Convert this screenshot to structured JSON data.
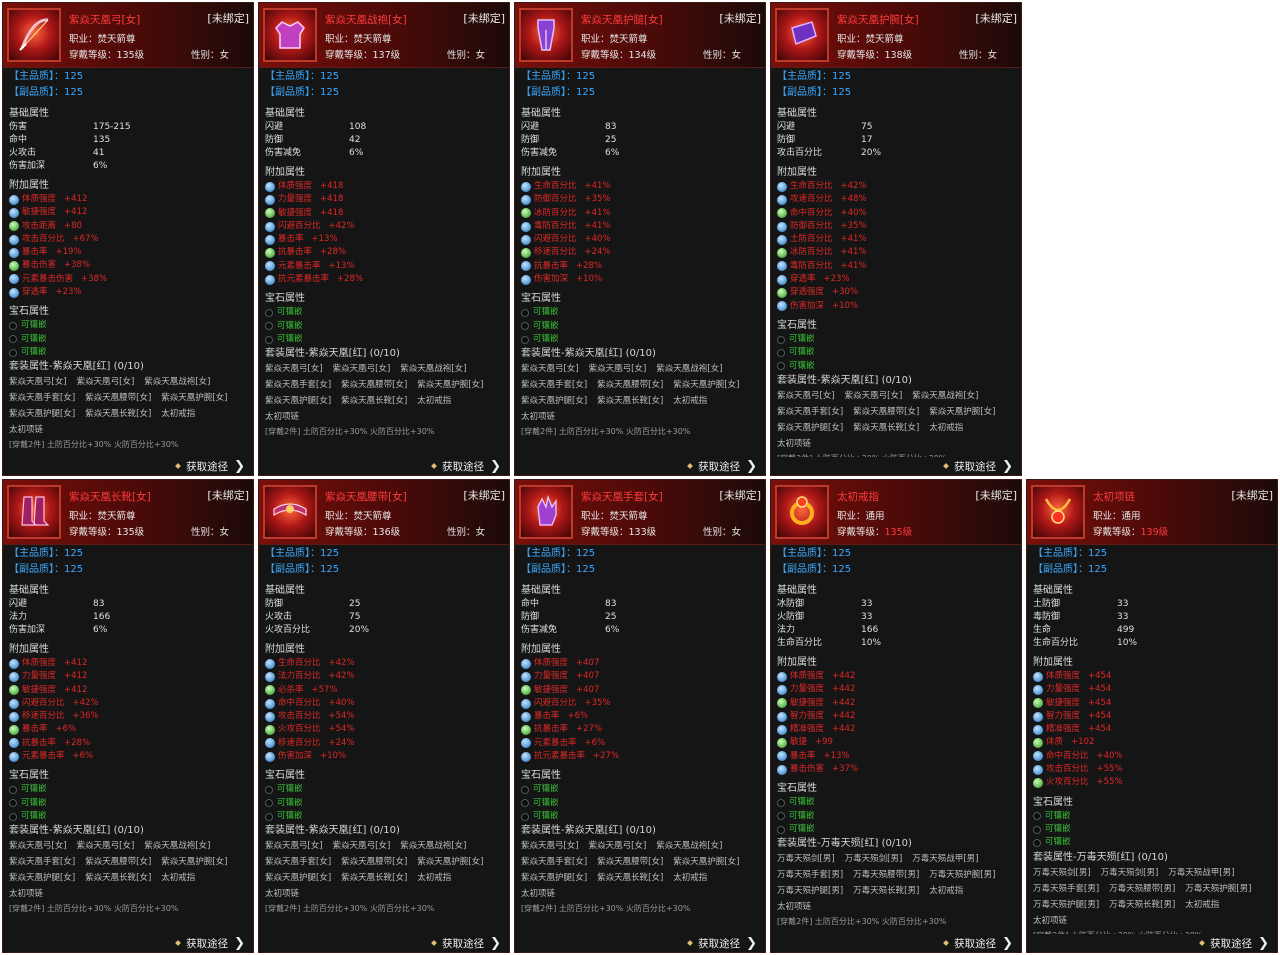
{
  "ui": {
    "unbound": "[未绑定]",
    "primary_quality_label": "【主品质】：",
    "secondary_quality_label": "【副品质】：",
    "basic_attr_label": "基础属性",
    "extra_attr_label": "附加属性",
    "gem_attr_label": "宝石属性",
    "gem_slot_label": "可镶嵌",
    "acquire_label": "获取途径",
    "class_label": "职业：",
    "level_label": "穿戴等级：",
    "gender_label": "性别：",
    "extra_set_line": "[穿戴2件] 土防百分比+30%   火防百分比+30%"
  },
  "colors": {
    "item_name": "#ff3c3c",
    "quality": "#3aa8ff",
    "gem_slot": "#38c038",
    "attr_red": "#e02828"
  },
  "set_ziyan": {
    "title": "套装属性-紫焱天凰[红] (0/10)",
    "rows": [
      [
        "紫焱天凰弓[女]",
        "紫焱天凰弓[女]",
        "紫焱天凰战袍[女]"
      ],
      [
        "紫焱天凰手套[女]",
        "紫焱天凰腰带[女]",
        "紫焱天凰护腕[女]"
      ],
      [
        "紫焱天凰护腿[女]",
        "紫焱天凰长靴[女]",
        "太初戒指"
      ],
      [
        "太初项链"
      ]
    ]
  },
  "set_wandu_m": {
    "title": "套装属性-万毒天殒[红] (0/10)",
    "rows": [
      [
        "万毒天殒剑[男]",
        "万毒天殒剑[男]",
        "万毒天殒战甲[男]"
      ],
      [
        "万毒天殒手套[男]",
        "万毒天殒腰带[男]",
        "万毒天殒护腕[男]"
      ],
      [
        "万毒天殒护腿[男]",
        "万毒天殒长靴[男]",
        "太初戒指"
      ],
      [
        "太初项链"
      ]
    ]
  },
  "items": [
    {
      "name": "紫焱天凰弓[女]",
      "icon": "bow-icon",
      "class": "焚天箭尊",
      "level": "135级",
      "level_red": false,
      "gender": "女",
      "primary_quality": "125",
      "secondary_quality": "125",
      "basic": [
        [
          "伤害",
          "175-215"
        ],
        [
          "命中",
          "135"
        ],
        [
          "火攻击",
          "41"
        ],
        [
          "伤害加深",
          "6%"
        ]
      ],
      "extra": [
        [
          "体质强度",
          "+412"
        ],
        [
          "敏捷强度",
          "+412"
        ],
        [
          "攻击距离",
          "+80"
        ],
        [
          "攻击百分比",
          "+67%"
        ],
        [
          "暴击率",
          "+19%"
        ],
        [
          "暴击伤害",
          "+38%"
        ],
        [
          "元素暴击伤害",
          "+38%"
        ],
        [
          "穿透率",
          "+23%"
        ]
      ],
      "gems": 3,
      "set": "set_ziyan"
    },
    {
      "name": "紫焱天凰战袍[女]",
      "icon": "armor-icon",
      "class": "焚天箭尊",
      "level": "137级",
      "level_red": false,
      "gender": "女",
      "primary_quality": "125",
      "secondary_quality": "125",
      "basic": [
        [
          "闪避",
          "108"
        ],
        [
          "防御",
          "42"
        ],
        [
          "伤害减免",
          "6%"
        ]
      ],
      "extra": [
        [
          "体质强度",
          "+418"
        ],
        [
          "力量强度",
          "+418"
        ],
        [
          "敏捷强度",
          "+418"
        ],
        [
          "闪避百分比",
          "+42%"
        ],
        [
          "暴击率",
          "+13%"
        ],
        [
          "抗暴击率",
          "+28%"
        ],
        [
          "元素暴击率",
          "+13%"
        ],
        [
          "抗元素暴击率",
          "+28%"
        ]
      ],
      "gems": 3,
      "set": "set_ziyan"
    },
    {
      "name": "紫焱天凰护腿[女]",
      "icon": "leggings-icon",
      "class": "焚天箭尊",
      "level": "134级",
      "level_red": false,
      "gender": "女",
      "primary_quality": "125",
      "secondary_quality": "125",
      "basic": [
        [
          "闪避",
          "83"
        ],
        [
          "防御",
          "25"
        ],
        [
          "伤害减免",
          "6%"
        ]
      ],
      "extra": [
        [
          "生命百分比",
          "+41%"
        ],
        [
          "防御百分比",
          "+35%"
        ],
        [
          "冰防百分比",
          "+41%"
        ],
        [
          "毒防百分比",
          "+41%"
        ],
        [
          "闪避百分比",
          "+40%"
        ],
        [
          "移速百分比",
          "+24%"
        ],
        [
          "抗暴击率",
          "+28%"
        ],
        [
          "伤害加深",
          "+10%"
        ]
      ],
      "gems": 3,
      "set": "set_ziyan"
    },
    {
      "name": "紫焱天凰护腕[女]",
      "icon": "bracer-icon",
      "class": "焚天箭尊",
      "level": "138级",
      "level_red": false,
      "gender": "女",
      "primary_quality": "125",
      "secondary_quality": "125",
      "basic": [
        [
          "闪避",
          "75"
        ],
        [
          "防御",
          "17"
        ],
        [
          "攻击百分比",
          "20%"
        ]
      ],
      "extra": [
        [
          "生命百分比",
          "+42%"
        ],
        [
          "攻速百分比",
          "+48%"
        ],
        [
          "命中百分比",
          "+40%"
        ],
        [
          "防御百分比",
          "+35%"
        ],
        [
          "土防百分比",
          "+41%"
        ],
        [
          "冰防百分比",
          "+41%"
        ],
        [
          "毒防百分比",
          "+41%"
        ],
        [
          "穿透率",
          "+23%"
        ],
        [
          "穿透强度",
          "+30%"
        ],
        [
          "伤害加深",
          "+10%"
        ]
      ],
      "gems": 3,
      "set": "set_ziyan"
    },
    {
      "name": "紫焱天凰长靴[女]",
      "icon": "boots-icon",
      "class": "焚天箭尊",
      "level": "135级",
      "level_red": false,
      "gender": "女",
      "primary_quality": "125",
      "secondary_quality": "125",
      "basic": [
        [
          "闪避",
          "83"
        ],
        [
          "法力",
          "166"
        ],
        [
          "伤害加深",
          "6%"
        ]
      ],
      "extra": [
        [
          "体质强度",
          "+412"
        ],
        [
          "力量强度",
          "+412"
        ],
        [
          "敏捷强度",
          "+412"
        ],
        [
          "闪避百分比",
          "+42%"
        ],
        [
          "移速百分比",
          "+36%"
        ],
        [
          "暴击率",
          "+6%"
        ],
        [
          "抗暴击率",
          "+28%"
        ],
        [
          "元素暴击率",
          "+6%"
        ]
      ],
      "gems": 3,
      "set": "set_ziyan"
    },
    {
      "name": "紫焱天凰腰带[女]",
      "icon": "belt-icon",
      "class": "焚天箭尊",
      "level": "136级",
      "level_red": false,
      "gender": "女",
      "primary_quality": "125",
      "secondary_quality": "125",
      "basic": [
        [
          "防御",
          "25"
        ],
        [
          "火攻击",
          "75"
        ],
        [
          "火攻百分比",
          "20%"
        ]
      ],
      "extra": [
        [
          "生命百分比",
          "+42%"
        ],
        [
          "法力百分比",
          "+42%"
        ],
        [
          "必杀率",
          "+57%"
        ],
        [
          "命中百分比",
          "+40%"
        ],
        [
          "攻击百分比",
          "+54%"
        ],
        [
          "火攻百分比",
          "+54%"
        ],
        [
          "移速百分比",
          "+24%"
        ],
        [
          "伤害加深",
          "+10%"
        ]
      ],
      "gems": 3,
      "set": "set_ziyan"
    },
    {
      "name": "紫焱天凰手套[女]",
      "icon": "glove-icon",
      "class": "焚天箭尊",
      "level": "133级",
      "level_red": false,
      "gender": "女",
      "primary_quality": "125",
      "secondary_quality": "125",
      "basic": [
        [
          "命中",
          "83"
        ],
        [
          "防御",
          "25"
        ],
        [
          "伤害减免",
          "6%"
        ]
      ],
      "extra": [
        [
          "体质强度",
          "+407"
        ],
        [
          "力量强度",
          "+407"
        ],
        [
          "敏捷强度",
          "+407"
        ],
        [
          "闪避百分比",
          "+35%"
        ],
        [
          "暴击率",
          "+6%"
        ],
        [
          "抗暴击率",
          "+27%"
        ],
        [
          "元素暴击率",
          "+6%"
        ],
        [
          "抗元素暴击率",
          "+27%"
        ]
      ],
      "gems": 3,
      "set": "set_ziyan"
    },
    {
      "name": "太初戒指",
      "icon": "ring-icon",
      "class": "通用",
      "level": "135级",
      "level_red": true,
      "gender": "",
      "primary_quality": "125",
      "secondary_quality": "125",
      "basic": [
        [
          "冰防御",
          "33"
        ],
        [
          "火防御",
          "33"
        ],
        [
          "法力",
          "166"
        ],
        [
          "生命百分比",
          "10%"
        ]
      ],
      "extra": [
        [
          "体质强度",
          "+442"
        ],
        [
          "力量强度",
          "+442"
        ],
        [
          "敏捷强度",
          "+442"
        ],
        [
          "智力强度",
          "+442"
        ],
        [
          "精准强度",
          "+442"
        ],
        [
          "敏捷",
          "+99"
        ],
        [
          "暴击率",
          "+13%"
        ],
        [
          "暴击伤害",
          "+37%"
        ]
      ],
      "gems": 3,
      "set": "set_wandu_m"
    },
    {
      "name": "太初项链",
      "icon": "necklace-icon",
      "class": "通用",
      "level": "139级",
      "level_red": true,
      "gender": "",
      "primary_quality": "125",
      "secondary_quality": "125",
      "basic": [
        [
          "土防御",
          "33"
        ],
        [
          "毒防御",
          "33"
        ],
        [
          "生命",
          "499"
        ],
        [
          "生命百分比",
          "10%"
        ]
      ],
      "extra": [
        [
          "体质强度",
          "+454"
        ],
        [
          "力量强度",
          "+454"
        ],
        [
          "敏捷强度",
          "+454"
        ],
        [
          "智力强度",
          "+454"
        ],
        [
          "精准强度",
          "+454"
        ],
        [
          "体质",
          "+102"
        ],
        [
          "命中百分比",
          "+40%"
        ],
        [
          "攻击百分比",
          "+55%"
        ],
        [
          "火攻百分比",
          "+55%"
        ]
      ],
      "gems": 3,
      "set": "set_wandu_m"
    }
  ]
}
